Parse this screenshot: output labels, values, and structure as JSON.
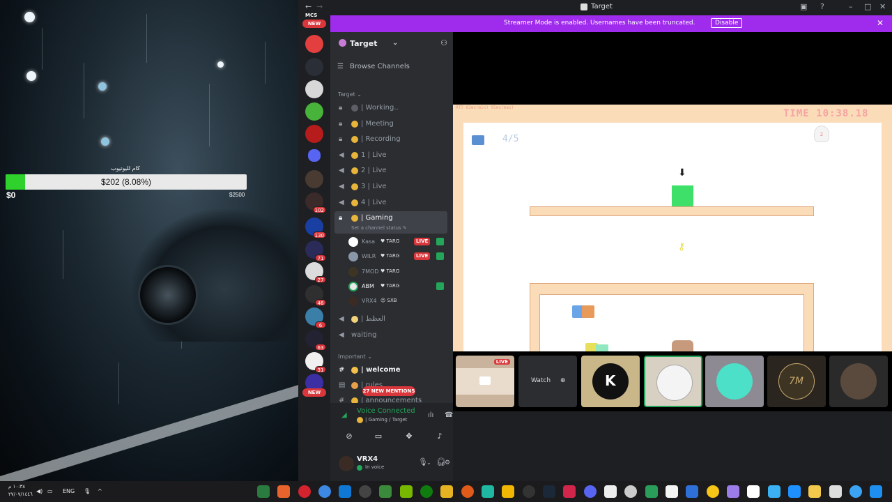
{
  "wallpaper": {
    "donation": {
      "label": "كام لليوتيوب",
      "text": "$202 (8.08%)",
      "min": "$0",
      "max": "$2500",
      "progress_percent": 8.08
    }
  },
  "window": {
    "title": "Target"
  },
  "banner": {
    "text": "Streamer Mode is enabled. Usernames have been truncated.",
    "disable_label": "Disable"
  },
  "servers": {
    "top_label": "MCS",
    "new_label": "NEW",
    "badges": [
      "102",
      "130",
      "71",
      "27",
      "46",
      "6",
      "63",
      "31"
    ],
    "bottom_new_label": "NEW"
  },
  "sidebar": {
    "server_name": "Target",
    "browse_channels": "Browse Channels",
    "category_target": "Target",
    "channels": [
      {
        "name": "| Working..",
        "icon": "lock-icon"
      },
      {
        "name": "| Meeting",
        "icon": "lock-icon"
      },
      {
        "name": "| Recording",
        "icon": "lock-icon"
      },
      {
        "name": "1 | Live",
        "icon": "voice-icon"
      },
      {
        "name": "2 | Live",
        "icon": "voice-icon"
      },
      {
        "name": "3 | Live",
        "icon": "voice-icon"
      },
      {
        "name": "4 | Live",
        "icon": "voice-icon"
      }
    ],
    "active_channel": {
      "name": "| Gaming",
      "status_placeholder": "Set a channel status"
    },
    "voice_users": [
      {
        "name": "Kasa",
        "tag": "TARG",
        "live": "LIVE"
      },
      {
        "name": "WILR",
        "tag": "TARG",
        "live": "LIVE"
      },
      {
        "name": "7MOD",
        "tag": "TARG",
        "live": ""
      },
      {
        "name": "ABM",
        "tag": "TARG",
        "live": ""
      },
      {
        "name": "VRX4",
        "tag": "SXB",
        "live": ""
      }
    ],
    "channel_after": "| العظط",
    "waiting": "waiting",
    "category_important": "Important",
    "welcome": "| welcome",
    "rules": "| rules",
    "announcements": "| announcements",
    "mentions_pill": "27 NEW MENTIONS"
  },
  "voice": {
    "status": "Voice Connected",
    "channel": "| Gaming / Target"
  },
  "user": {
    "name": "VRX4",
    "status": "In voice"
  },
  "game": {
    "rtt": "RTT 63ms(min) 95ms(max)",
    "time": "TIME 10:38.18",
    "score": "4/5",
    "ghost_count": "2"
  },
  "strip": {
    "live_label": "LIVE",
    "watch_label": "Watch"
  },
  "taskbar": {
    "time": "١٠:٣٨ م",
    "date": "٢٧/٠٧/١٤٤٦",
    "language": "ENG"
  }
}
